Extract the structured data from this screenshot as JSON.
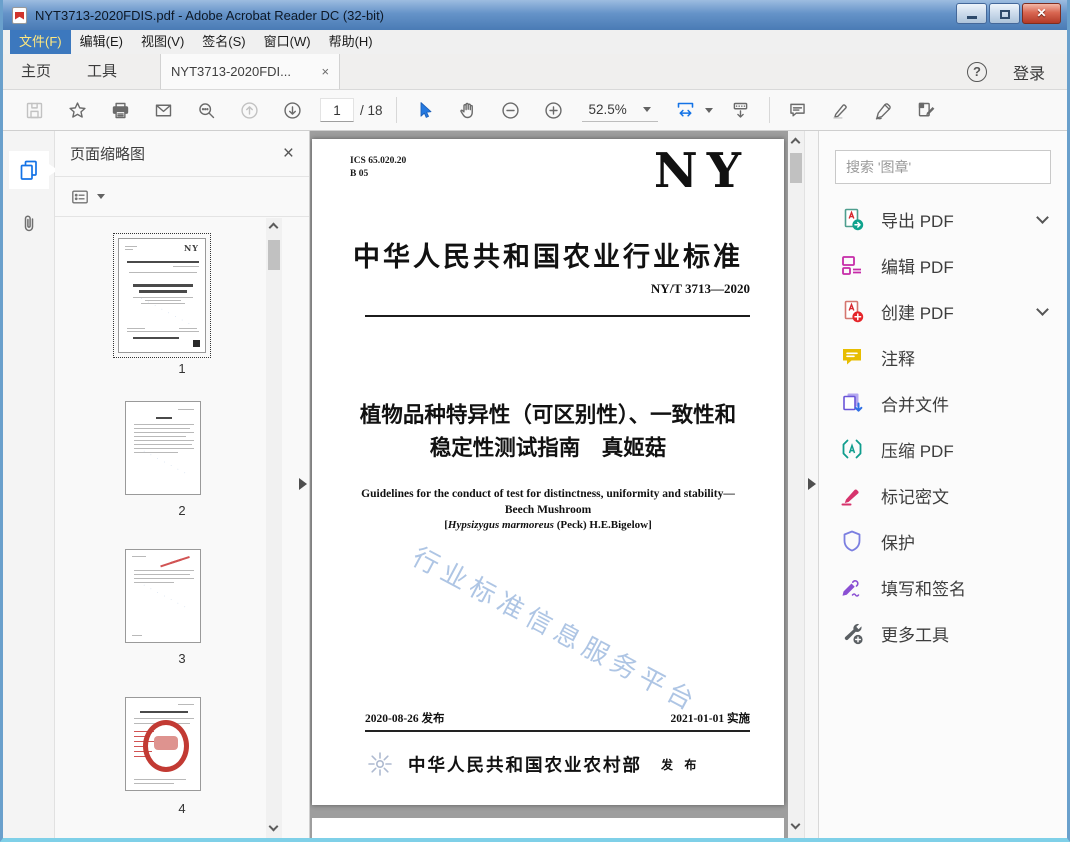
{
  "window": {
    "title": "NYT3713-2020FDIS.pdf - Adobe Acrobat Reader DC (32-bit)"
  },
  "menubar": {
    "items": [
      {
        "label": "文件(F)",
        "active": true
      },
      {
        "label": "编辑(E)"
      },
      {
        "label": "视图(V)"
      },
      {
        "label": "签名(S)"
      },
      {
        "label": "窗口(W)"
      },
      {
        "label": "帮助(H)"
      }
    ]
  },
  "tabbar": {
    "home": "主页",
    "tools": "工具",
    "document_tab": "NYT3713-2020FDI...",
    "close_glyph": "×",
    "help_glyph": "?",
    "login": "登录"
  },
  "toolbar": {
    "page_current": "1",
    "page_total_label": "/ 18",
    "zoom_value": "52.5%",
    "icon_names": [
      "save-icon",
      "favorites-star-icon",
      "print-icon",
      "email-icon",
      "search-icon",
      "page-up-icon",
      "page-down-icon",
      "select-tool-icon",
      "hand-tool-icon",
      "zoom-out-icon",
      "zoom-in-icon",
      "fit-width-icon",
      "scroll-mode-icon",
      "comment-icon",
      "highlight-icon",
      "sign-icon",
      "fill-sign-icon"
    ]
  },
  "nav_rail": {
    "icon_names": [
      "page-thumbnails-icon",
      "attachments-icon"
    ]
  },
  "left_panel": {
    "title": "页面缩略图",
    "close_glyph": "×",
    "thumbnails": [
      {
        "label": "1",
        "selected": true
      },
      {
        "label": "2"
      },
      {
        "label": "3"
      },
      {
        "label": "4"
      }
    ]
  },
  "document": {
    "ics": "ICS 65.020.20",
    "class_code": "B 05",
    "logo": "NY",
    "standard_name": "中华人民共和国农业行业标准",
    "standard_number": "NY/T 3713—2020",
    "title_line1": "植物品种特异性（可区别性）、一致性和",
    "title_line2": "稳定性测试指南　真姬菇",
    "subtitle_en_line1": "Guidelines for the conduct of test for distinctness, uniformity and stability—",
    "subtitle_en_line2": "Beech Mushroom",
    "latin_open": "[",
    "latin_species": "Hypsizygus marmoreus",
    "latin_rest": " (Peck) H.E.Bigelow]",
    "watermark": "行业标准信息服务平台",
    "issue_date": "2020-08-26 发布",
    "implement_date": "2021-01-01 实施",
    "publisher": "中华人民共和国农业农村部",
    "publish_label": "发 布"
  },
  "right_panel": {
    "search_placeholder": "搜索 '图章'",
    "tools": [
      {
        "label": "导出 PDF",
        "icon": "export-pdf-icon",
        "expandable": true
      },
      {
        "label": "编辑 PDF",
        "icon": "edit-pdf-icon",
        "expandable": false
      },
      {
        "label": "创建 PDF",
        "icon": "create-pdf-icon",
        "expandable": true
      },
      {
        "label": "注释",
        "icon": "comment-icon",
        "expandable": false
      },
      {
        "label": "合并文件",
        "icon": "combine-files-icon",
        "expandable": false
      },
      {
        "label": "压缩 PDF",
        "icon": "compress-pdf-icon",
        "expandable": false
      },
      {
        "label": "标记密文",
        "icon": "redact-icon",
        "expandable": false
      },
      {
        "label": "保护",
        "icon": "protect-icon",
        "expandable": false
      },
      {
        "label": "填写和签名",
        "icon": "fill-sign-icon",
        "expandable": false
      },
      {
        "label": "更多工具",
        "icon": "more-tools-icon",
        "expandable": false
      }
    ]
  },
  "colors": {
    "accent_blue": "#1473e6",
    "titlebar_blue": "#4a7bb5",
    "menu_highlight_text": "#ffe87f",
    "document_bg": "#9e9e9e",
    "watermark_blue": "#6c96cd"
  }
}
